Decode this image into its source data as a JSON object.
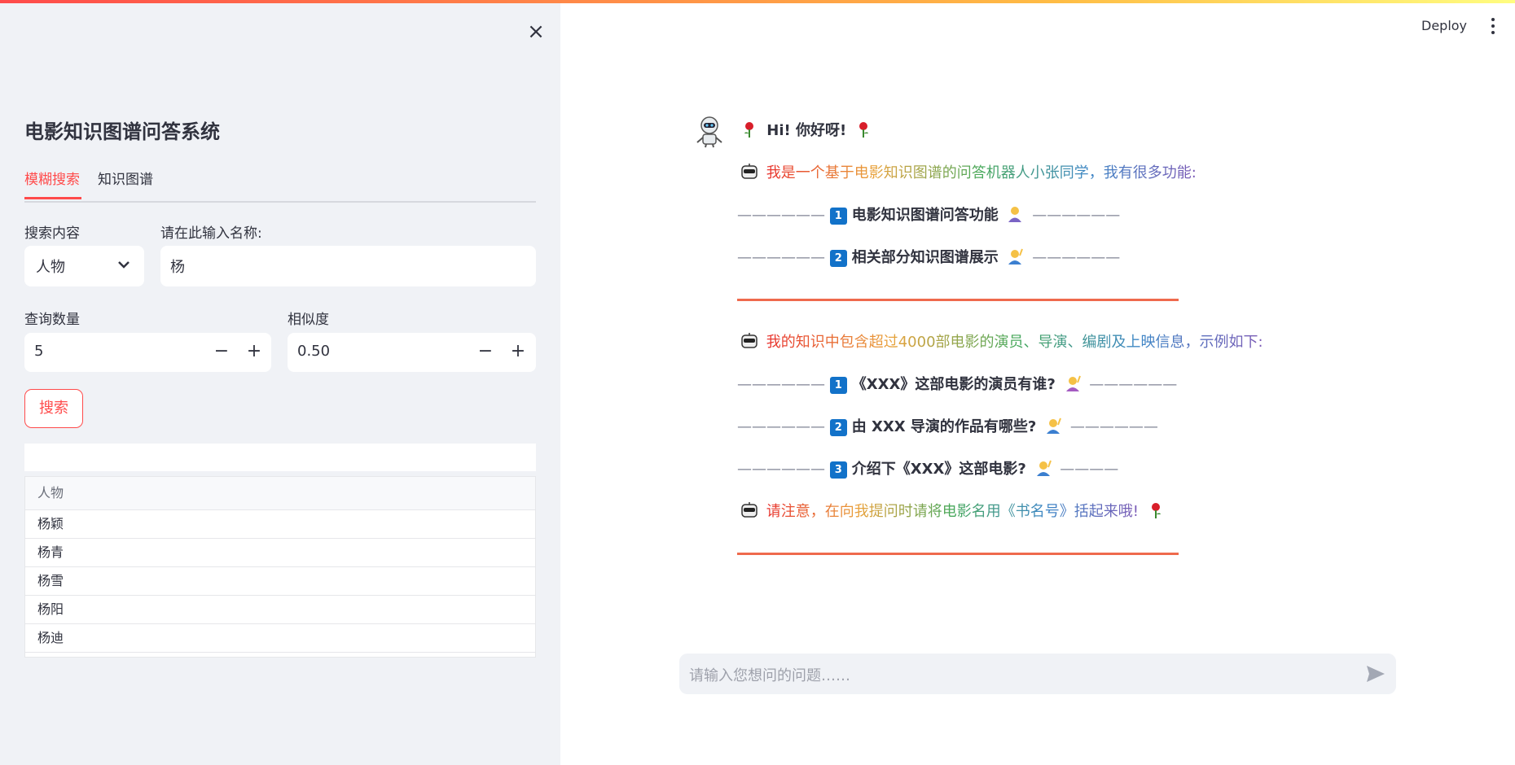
{
  "sidebar": {
    "close_icon": "×",
    "title": "电影知识图谱问答系统",
    "tabs": [
      {
        "label": "模糊搜索",
        "active": true
      },
      {
        "label": "知识图谱",
        "active": false
      }
    ],
    "search_type": {
      "label": "搜索内容",
      "value": "人物",
      "chevron": "⌄"
    },
    "name_input": {
      "label": "请在此输入名称:",
      "value": "杨"
    },
    "count": {
      "label": "查询数量",
      "value": "5",
      "minus": "−",
      "plus": "+"
    },
    "similarity": {
      "label": "相似度",
      "value": "0.50",
      "minus": "−",
      "plus": "+"
    },
    "search_button": "搜索",
    "results": {
      "column": "人物",
      "rows": [
        "杨颖",
        "杨青",
        "杨雪",
        "杨阳",
        "杨迪"
      ]
    }
  },
  "header": {
    "deploy": "Deploy"
  },
  "chat": {
    "hi": "Hi! 你好呀!",
    "intro": "我是一个基于电影知识图谱的问答机器人小张同学，我有很多功能:",
    "feature_1": "电影知识图谱问答功能",
    "feature_2": "相关部分知识图谱展示",
    "knowledge": "我的知识中包含超过4000部电影的演员、导演、编剧及上映信息，示例如下:",
    "example_1": "《XXX》这部电影的演员有谁?",
    "example_2": "由 XXX 导演的作品有哪些?",
    "example_3": "介绍下《XXX》这部电影?",
    "notice": "请注意，在向我提问时请将电影名用《书名号》括起来哦!",
    "dash_left": "——————",
    "dash_right": "——————",
    "dash_right_short": "————",
    "key_1": "1",
    "key_2": "2",
    "key_3": "3"
  },
  "chat_input": {
    "placeholder": "请输入您想问的问题……"
  },
  "colors": {
    "accent": "#ff4b4b",
    "sidebar_bg": "#f0f2f6",
    "key_blue": "#1272c9",
    "rule": "#ef6a4d"
  }
}
